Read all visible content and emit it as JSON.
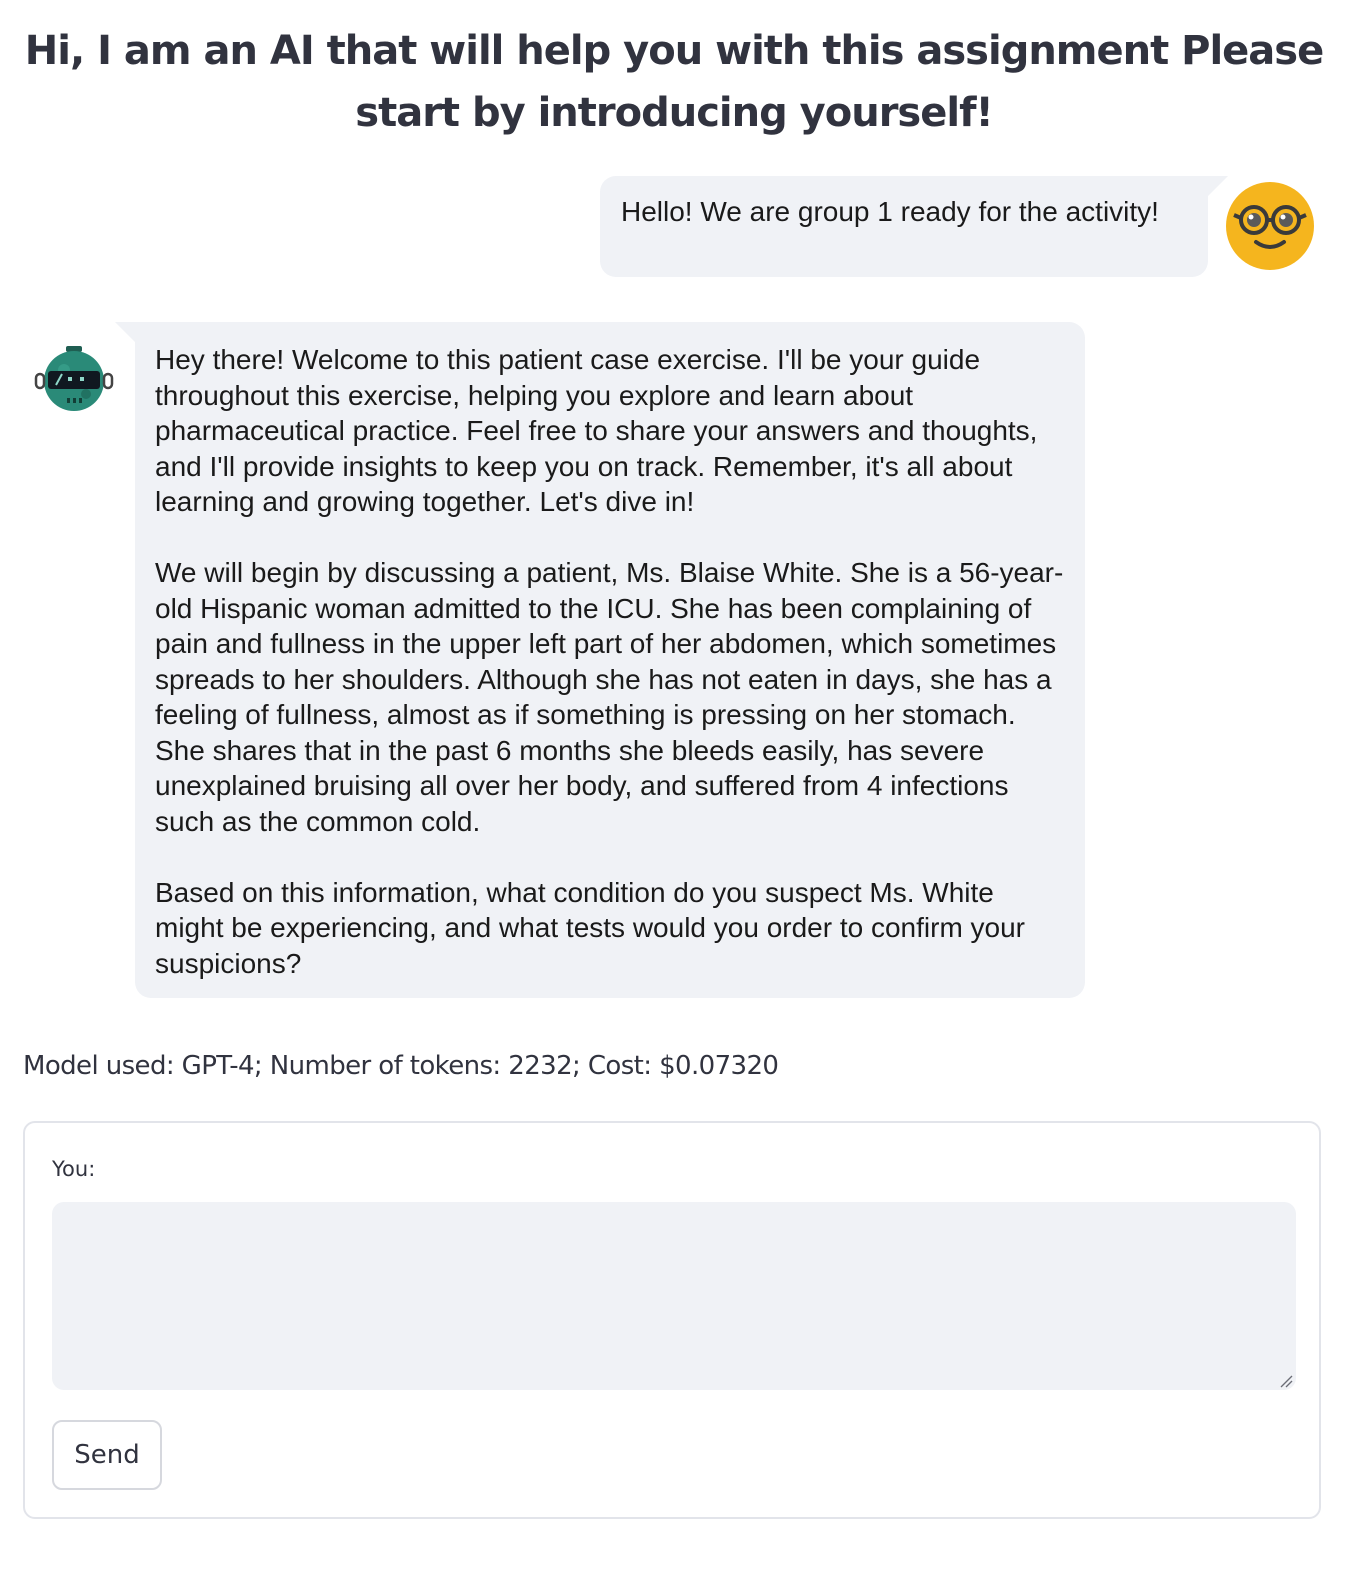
{
  "header": {
    "title": "Hi, I am an AI that will help you with this assignment Please start by introducing yourself!"
  },
  "messages": {
    "user": {
      "avatar_icon": "nerd-face-icon",
      "text": "Hello! We are group 1 ready for the activity!"
    },
    "assistant": {
      "avatar_icon": "robot-icon",
      "paragraphs": [
        "Hey there! Welcome to this patient case exercise. I'll be your guide throughout this exercise, helping you explore and learn about pharmaceutical practice. Feel free to share your answers and thoughts, and I'll provide insights to keep you on track. Remember, it's all about learning and growing together. Let's dive in!",
        "We will begin by discussing a patient, Ms. Blaise White. She is a 56-year-old Hispanic woman admitted to the ICU. She has been complaining of pain and fullness in the upper left part of her abdomen, which sometimes spreads to her shoulders. Although she has not eaten in days, she has a feeling of fullness, almost as if something is pressing on her stomach. She shares that in the past 6 months she bleeds easily, has severe unexplained bruising all over her body, and suffered from 4 infections such as the common cold.",
        "Based on this information, what condition do you suspect Ms. White might be experiencing, and what tests would you order to confirm your suspicions?"
      ]
    }
  },
  "usage": {
    "text": "Model used: GPT-4; Number of tokens: 2232; Cost: $0.07320"
  },
  "form": {
    "label": "You:",
    "input_value": "",
    "send_label": "Send"
  },
  "colors": {
    "bubble_bg": "#f0f2f6",
    "text": "#31333f",
    "user_avatar": "#f5b51e",
    "bot_avatar": "#2a8a78"
  }
}
